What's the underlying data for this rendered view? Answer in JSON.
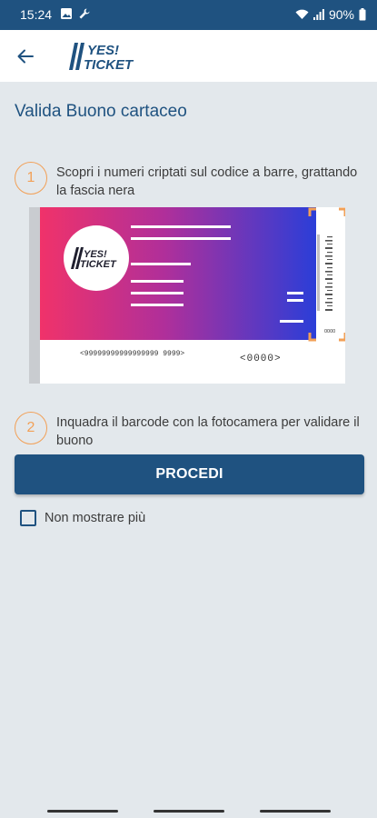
{
  "status_bar": {
    "time": "15:24",
    "battery": "90%",
    "icons_left": [
      "image-icon",
      "wrench-icon"
    ],
    "icons_right": [
      "wifi-icon",
      "signal-icon",
      "battery-icon"
    ]
  },
  "app_bar": {
    "back_icon": "arrow-left-icon",
    "logo_line1": "YES!",
    "logo_line2": "TICKET"
  },
  "page": {
    "title": "Valida Buono cartaceo"
  },
  "steps": [
    {
      "number": "1",
      "text": "Scopri i numeri criptati sul codice a barre, grattando la fascia nera"
    },
    {
      "number": "2",
      "text": "Inquadra il barcode con la fotocamera per validare il buono"
    }
  ],
  "ticket_illustration": {
    "logo_line1": "YES!",
    "logo_line2": "TICKET",
    "code_line": "<99999999999999999 9999>",
    "code_short": "<0000>",
    "barcode_number": "0000"
  },
  "actions": {
    "procedi_label": "PROCEDI",
    "checkbox_label": "Non mostrare più",
    "checkbox_checked": false
  },
  "colors": {
    "primary": "#1f5280",
    "accent": "#f2a057",
    "background": "#e3e8ec",
    "gradient_start": "#f0326a",
    "gradient_end": "#2b3ed8"
  }
}
